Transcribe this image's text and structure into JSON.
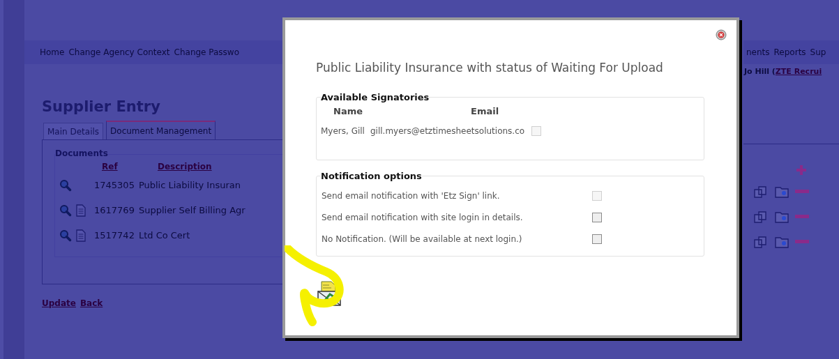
{
  "nav": {
    "items_left": [
      "Home",
      "Change Agency Context",
      "Change Passwo"
    ],
    "items_right": [
      "nents",
      "Reports",
      "Sup"
    ]
  },
  "user": {
    "name": "Jo Hill (",
    "link": "ZTE Recrui"
  },
  "page_title": "Supplier Entry",
  "tabs": [
    {
      "label": "Main Details",
      "selected": false
    },
    {
      "label": "Document Management",
      "selected": true
    }
  ],
  "documents": {
    "legend": "Documents",
    "columns": [
      "Ref",
      "Description"
    ],
    "rows": [
      {
        "ref": "1745305",
        "description": "Public Liability Insuran",
        "has_file": false
      },
      {
        "ref": "1617769",
        "description": "Supplier Self Billing Agr",
        "has_file": true
      },
      {
        "ref": "1517742",
        "description": "Ltd Co Cert",
        "has_file": true
      }
    ]
  },
  "actions": [
    "Update",
    "Back"
  ],
  "dialog": {
    "title": "Public Liability Insurance with status of Waiting For Upload",
    "signatories": {
      "legend": "Available Signatories",
      "columns": [
        "Name",
        "Email"
      ],
      "rows": [
        {
          "name": "Myers, Gill",
          "email": "gill.myers@etztimesheetsolutions.co",
          "checked": false,
          "disabled": true
        }
      ]
    },
    "notifications": {
      "legend": "Notification options",
      "options": [
        {
          "label": "Send email notification with 'Etz Sign' link.",
          "checked": false,
          "disabled": true
        },
        {
          "label": "Send email notification with site login in details.",
          "checked": false,
          "disabled": false
        },
        {
          "label": "No Notification. (Will be available at next login.)",
          "checked": false,
          "disabled": false
        }
      ]
    }
  }
}
